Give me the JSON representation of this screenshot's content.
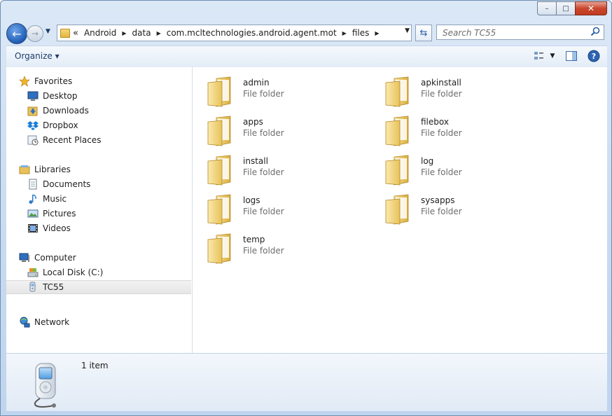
{
  "window": {
    "caption_buttons": {
      "minimize": "–",
      "maximize": "□",
      "close": "✕"
    }
  },
  "navigation": {
    "back_icon": "back-arrow-icon",
    "forward_icon": "forward-arrow-icon",
    "breadcrumb": [
      "Android",
      "data",
      "com.mcltechnologies.android.agent.mot",
      "files"
    ],
    "overflow": "«",
    "search_placeholder": "Search TC55"
  },
  "toolbar": {
    "organize_label": "Organize ▾"
  },
  "sidebar": {
    "favorites": {
      "label": "Favorites",
      "items": [
        "Desktop",
        "Downloads",
        "Dropbox",
        "Recent Places"
      ]
    },
    "libraries": {
      "label": "Libraries",
      "items": [
        "Documents",
        "Music",
        "Pictures",
        "Videos"
      ]
    },
    "computer": {
      "label": "Computer",
      "items": [
        "Local Disk (C:)",
        "TC55"
      ],
      "selected": "TC55"
    },
    "network": {
      "label": "Network"
    }
  },
  "folders": [
    {
      "name": "admin",
      "type": "File folder"
    },
    {
      "name": "apkinstall",
      "type": "File folder"
    },
    {
      "name": "apps",
      "type": "File folder"
    },
    {
      "name": "filebox",
      "type": "File folder"
    },
    {
      "name": "install",
      "type": "File folder"
    },
    {
      "name": "log",
      "type": "File folder"
    },
    {
      "name": "logs",
      "type": "File folder"
    },
    {
      "name": "sysapps",
      "type": "File folder"
    },
    {
      "name": "temp",
      "type": "File folder"
    }
  ],
  "details": {
    "count": "1 item"
  },
  "colors": {
    "accent": "#1f5db5",
    "folder": "#e9c45a",
    "selection": "#e6e6e6"
  }
}
